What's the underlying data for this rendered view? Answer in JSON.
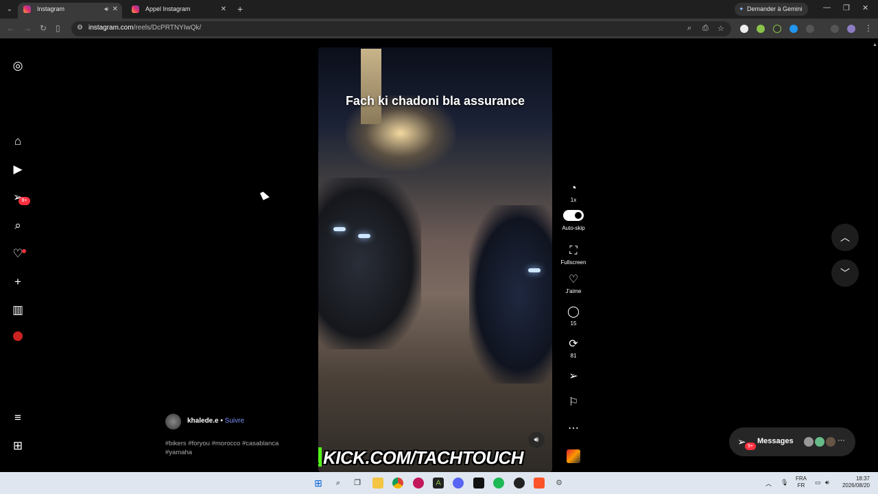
{
  "browser": {
    "tabs": [
      {
        "title": "Instagram",
        "active": true,
        "audio": true
      },
      {
        "title": "Appel Instagram",
        "active": false,
        "audio": false
      }
    ],
    "gemini_label": "Demander à Gemini",
    "url_domain": "instagram.com",
    "url_path": "/reels/DcPRTNYIwQk/"
  },
  "sidebar": {
    "notification_badge": "9+"
  },
  "reel": {
    "caption_overlay": "Fach ki chadoni bla assurance",
    "kick_letter": "K",
    "kick_text": "KICK.COM/TACHTOUCH",
    "author": "khalede.e",
    "follow_label": "Suivre",
    "separator": "•",
    "hashtags": "#bikers #foryou #morocco #casablanca #yamaha"
  },
  "actions": {
    "speed_label": "1x",
    "autoskip_label": "Auto-skip",
    "autoskip_on": true,
    "fullscreen_label": "Fullscreen",
    "like_label": "J'aime",
    "comments_count": "15",
    "reposts_count": "81"
  },
  "messages": {
    "label": "Messages",
    "badge": "9+"
  },
  "taskbar": {
    "lang_top": "FRA",
    "lang_bottom": "FR",
    "time": "18:37",
    "date": "2026/08/20"
  },
  "colors": {
    "accent_follow": "#7d95ff",
    "badge_red": "#ff3040",
    "kick_green": "#53fc18"
  }
}
